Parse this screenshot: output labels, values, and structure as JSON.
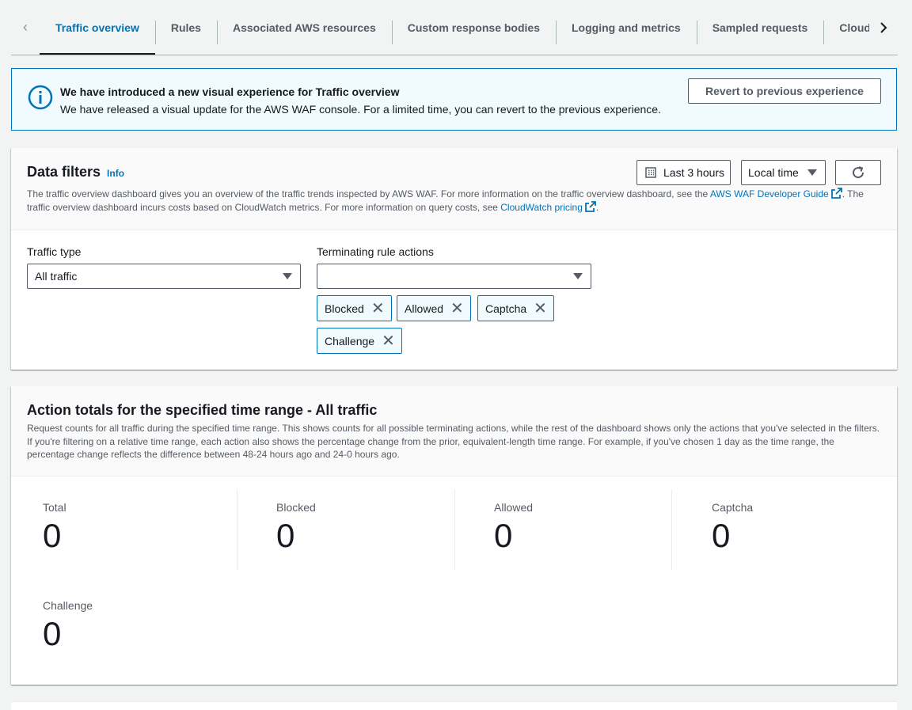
{
  "tabs": [
    {
      "label": "Traffic overview",
      "active": true
    },
    {
      "label": "Rules"
    },
    {
      "label": "Associated AWS resources"
    },
    {
      "label": "Custom response bodies"
    },
    {
      "label": "Logging and metrics"
    },
    {
      "label": "Sampled requests"
    },
    {
      "label": "CloudWatch"
    }
  ],
  "banner": {
    "title": "We have introduced a new visual experience for Traffic overview",
    "text": "We have released a visual update for the AWS WAF console. For a limited time, you can revert to the previous experience.",
    "button": "Revert to previous experience"
  },
  "filters": {
    "title": "Data filters",
    "info": "Info",
    "desc_1": "The traffic overview dashboard gives you an overview of the traffic trends inspected by AWS WAF. For more information on the traffic overview dashboard, see the ",
    "link_guide": "AWS WAF Developer Guide",
    "desc_2": ". The traffic overview dashboard incurs costs based on CloudWatch metrics. For more information on query costs, see ",
    "link_pricing": "CloudWatch pricing",
    "desc_3": ".",
    "time_range": "Last 3 hours",
    "timezone": "Local time",
    "traffic_type_label": "Traffic type",
    "traffic_type_value": "All traffic",
    "actions_label": "Terminating rule actions",
    "actions_value": "",
    "tokens": [
      "Blocked",
      "Allowed",
      "Captcha",
      "Challenge"
    ]
  },
  "totals": {
    "title": "Action totals for the specified time range - All traffic",
    "desc": "Request counts for all traffic during the specified time range. This shows counts for all possible terminating actions, while the rest of the dashboard shows only the actions that you've selected in the filters. If you're filtering on a relative time range, each action also shows the percentage change from the prior, equivalent-length time range. For example, if you've chosen 1 day as the time range, the percentage change reflects the difference between 48-24 hours ago and 24-0 hours ago.",
    "metrics": [
      {
        "label": "Total",
        "value": "0"
      },
      {
        "label": "Blocked",
        "value": "0"
      },
      {
        "label": "Allowed",
        "value": "0"
      },
      {
        "label": "Captcha",
        "value": "0"
      },
      {
        "label": "Challenge",
        "value": "0"
      }
    ]
  },
  "icons": {
    "prev": "chevron-left-icon",
    "next": "chevron-right-icon",
    "info": "info-circle-icon",
    "calendar": "calendar-icon",
    "refresh": "refresh-icon",
    "external": "external-link-icon",
    "remove": "close-icon"
  },
  "colors": {
    "accent": "#0073bb",
    "banner_bg": "#f1faff",
    "text": "#16191f",
    "muted": "#545b64"
  }
}
